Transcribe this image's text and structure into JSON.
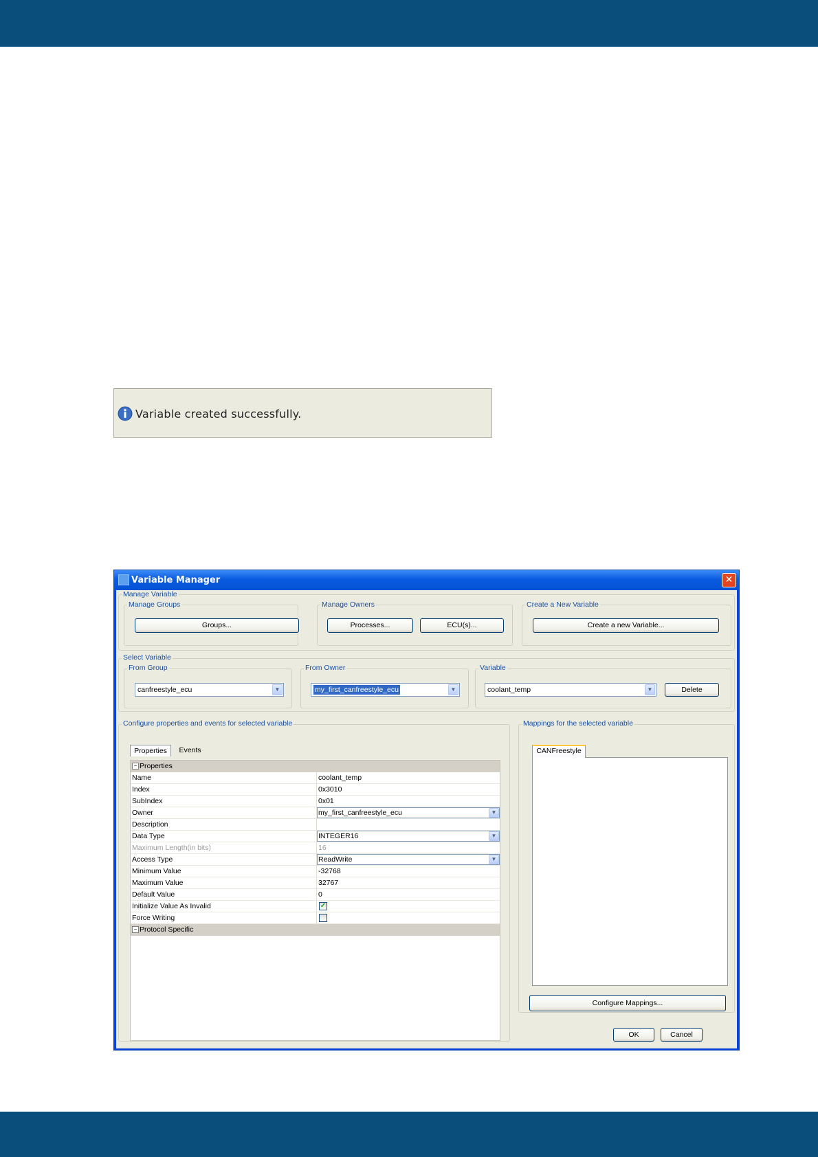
{
  "info": {
    "message": "Variable created successfully."
  },
  "dialog": {
    "title": "Variable Manager",
    "close_glyph": "✕",
    "manage_variable": {
      "legend": "Manage Variable",
      "groups": {
        "legend": "Manage Groups",
        "button": "Groups..."
      },
      "owners": {
        "legend": "Manage Owners",
        "processes_button": "Processes...",
        "ecus_button": "ECU(s)..."
      },
      "create": {
        "legend": "Create a New Variable",
        "button": "Create a new Variable..."
      }
    },
    "select_variable": {
      "legend": "Select Variable",
      "from_group": {
        "legend": "From Group",
        "value": "canfreestyle_ecu"
      },
      "from_owner": {
        "legend": "From Owner",
        "value": "my_first_canfreestyle_ecu"
      },
      "variable": {
        "legend": "Variable",
        "value": "coolant_temp",
        "delete_button": "Delete"
      }
    },
    "configure": {
      "legend": "Configure properties and events for selected variable",
      "tabs": [
        "Properties",
        "Events"
      ],
      "category_properties": "Properties",
      "category_protocol": "Protocol Specific",
      "rows": [
        {
          "name": "Name",
          "value": "coolant_temp"
        },
        {
          "name": "Index",
          "value": "0x3010"
        },
        {
          "name": "SubIndex",
          "value": "0x01"
        },
        {
          "name": "Owner",
          "value": "my_first_canfreestyle_ecu"
        },
        {
          "name": "Description",
          "value": ""
        },
        {
          "name": "Data Type",
          "value": "INTEGER16"
        },
        {
          "name": "Maximum Length(in bits)",
          "value": "16"
        },
        {
          "name": "Access Type",
          "value": "ReadWrite"
        },
        {
          "name": "Minimum Value",
          "value": "-32768"
        },
        {
          "name": "Maximum Value",
          "value": "32767"
        },
        {
          "name": "Default Value",
          "value": "0"
        },
        {
          "name": "Initialize Value As Invalid",
          "value": "✓"
        },
        {
          "name": "Force Writing",
          "value": ""
        }
      ]
    },
    "mappings": {
      "legend": "Mappings for the selected variable",
      "tab": "CANFreestyle",
      "configure_button": "Configure Mappings..."
    },
    "ok_button": "OK",
    "cancel_button": "Cancel"
  },
  "icons": {
    "info": "info-icon",
    "dropdown": "chevron-down-icon",
    "close": "close-icon"
  },
  "colors": {
    "band": "#0a4f7c",
    "xp_title": "#0a5be0",
    "dialog_bg": "#ecebe0",
    "legend_text": "#1b4f9e"
  }
}
